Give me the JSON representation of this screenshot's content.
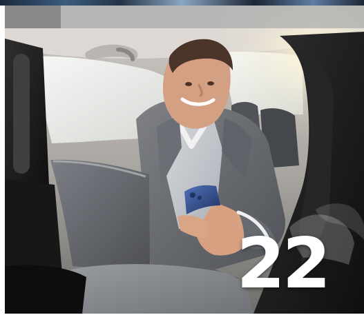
{
  "hero": {
    "number_badge": "22"
  },
  "icons": {
    "handle_icon": "grab-handle-icon",
    "image_icon": "car-interior-photo"
  }
}
